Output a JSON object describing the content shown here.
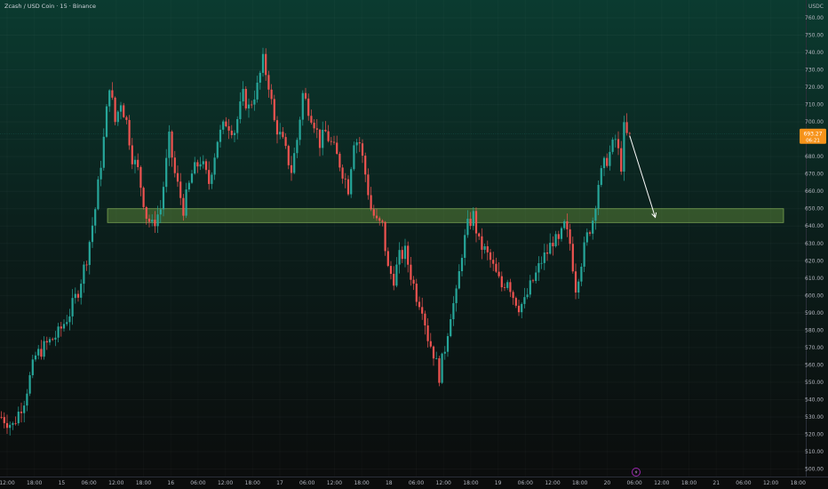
{
  "header": {
    "title": "Zcash / USD Coin · 15 · Binance",
    "currency": "USDC"
  },
  "price_badge": {
    "price": "693.27",
    "countdown": "06:21"
  },
  "colors": {
    "up": "#26a69a",
    "down": "#ef5350",
    "zone_fill": "#8bc34a",
    "zone_stroke": "#9ccc65",
    "badge": "#f7931a",
    "arrow": "#ffffff",
    "event_marker": "#9c27b0"
  },
  "chart_data": {
    "type": "candlestick",
    "symbol": "Zcash / USD Coin",
    "interval": "15",
    "exchange": "Binance",
    "quote_currency": "USDC",
    "ylim": [
      496,
      767
    ],
    "y_ticks": [
      500,
      510,
      520,
      530,
      540,
      550,
      560,
      570,
      580,
      590,
      600,
      610,
      620,
      630,
      640,
      650,
      660,
      670,
      680,
      690,
      700,
      710,
      720,
      730,
      740,
      750,
      760
    ],
    "x_ticks": [
      "12:00",
      "18:00",
      "15",
      "06:00",
      "12:00",
      "18:00",
      "16",
      "06:00",
      "12:00",
      "18:00",
      "17",
      "06:00",
      "12:00",
      "18:00",
      "18",
      "06:00",
      "12:00",
      "18:00",
      "19",
      "06:00",
      "12:00",
      "18:00",
      "20",
      "06:00",
      "12:00",
      "18:00",
      "21",
      "06:00",
      "12:00",
      "18:00"
    ],
    "last_price": 693.27,
    "price_path": [
      [
        0,
        530
      ],
      [
        4,
        525
      ],
      [
        8,
        540
      ],
      [
        12,
        565
      ],
      [
        16,
        572
      ],
      [
        20,
        578
      ],
      [
        24,
        590
      ],
      [
        27,
        603
      ],
      [
        30,
        622
      ],
      [
        33,
        650
      ],
      [
        36,
        690
      ],
      [
        38,
        722
      ],
      [
        40,
        700
      ],
      [
        42,
        712
      ],
      [
        44,
        700
      ],
      [
        46,
        680
      ],
      [
        48,
        672
      ],
      [
        51,
        646
      ],
      [
        53,
        640
      ],
      [
        56,
        650
      ],
      [
        59,
        690
      ],
      [
        61,
        670
      ],
      [
        64,
        650
      ],
      [
        67,
        670
      ],
      [
        70,
        678
      ],
      [
        73,
        665
      ],
      [
        76,
        690
      ],
      [
        79,
        700
      ],
      [
        82,
        695
      ],
      [
        85,
        715
      ],
      [
        87,
        708
      ],
      [
        90,
        720
      ],
      [
        92,
        735
      ],
      [
        94,
        722
      ],
      [
        96,
        700
      ],
      [
        99,
        688
      ],
      [
        102,
        672
      ],
      [
        104,
        690
      ],
      [
        106,
        716
      ],
      [
        108,
        708
      ],
      [
        110,
        700
      ],
      [
        112,
        688
      ],
      [
        114,
        694
      ],
      [
        117,
        684
      ],
      [
        119,
        676
      ],
      [
        122,
        662
      ],
      [
        124,
        690
      ],
      [
        126,
        688
      ],
      [
        128,
        670
      ],
      [
        130,
        650
      ],
      [
        132,
        642
      ],
      [
        134,
        640
      ],
      [
        136,
        615
      ],
      [
        138,
        610
      ],
      [
        140,
        622
      ],
      [
        142,
        625
      ],
      [
        144,
        612
      ],
      [
        146,
        600
      ],
      [
        148,
        594
      ],
      [
        150,
        576
      ],
      [
        152,
        567
      ],
      [
        154,
        554
      ],
      [
        156,
        570
      ],
      [
        158,
        590
      ],
      [
        160,
        600
      ],
      [
        162,
        625
      ],
      [
        164,
        640
      ],
      [
        166,
        646
      ],
      [
        168,
        630
      ],
      [
        170,
        626
      ],
      [
        172,
        620
      ],
      [
        174,
        612
      ],
      [
        176,
        605
      ],
      [
        178,
        610
      ],
      [
        180,
        600
      ],
      [
        182,
        594
      ],
      [
        184,
        596
      ],
      [
        186,
        605
      ],
      [
        188,
        612
      ],
      [
        190,
        620
      ],
      [
        192,
        625
      ],
      [
        194,
        632
      ],
      [
        196,
        630
      ],
      [
        198,
        640
      ],
      [
        200,
        630
      ],
      [
        202,
        605
      ],
      [
        204,
        620
      ],
      [
        206,
        634
      ],
      [
        208,
        644
      ],
      [
        210,
        665
      ],
      [
        212,
        675
      ],
      [
        214,
        682
      ],
      [
        216,
        690
      ],
      [
        218,
        675
      ],
      [
        219,
        696
      ],
      [
        220,
        692
      ],
      [
        221,
        693.27
      ]
    ],
    "support_zone": {
      "low": 642,
      "high": 650
    },
    "annotations": [
      {
        "type": "arrow",
        "from": [
          221,
          692
        ],
        "to": [
          230,
          645
        ]
      }
    ]
  }
}
